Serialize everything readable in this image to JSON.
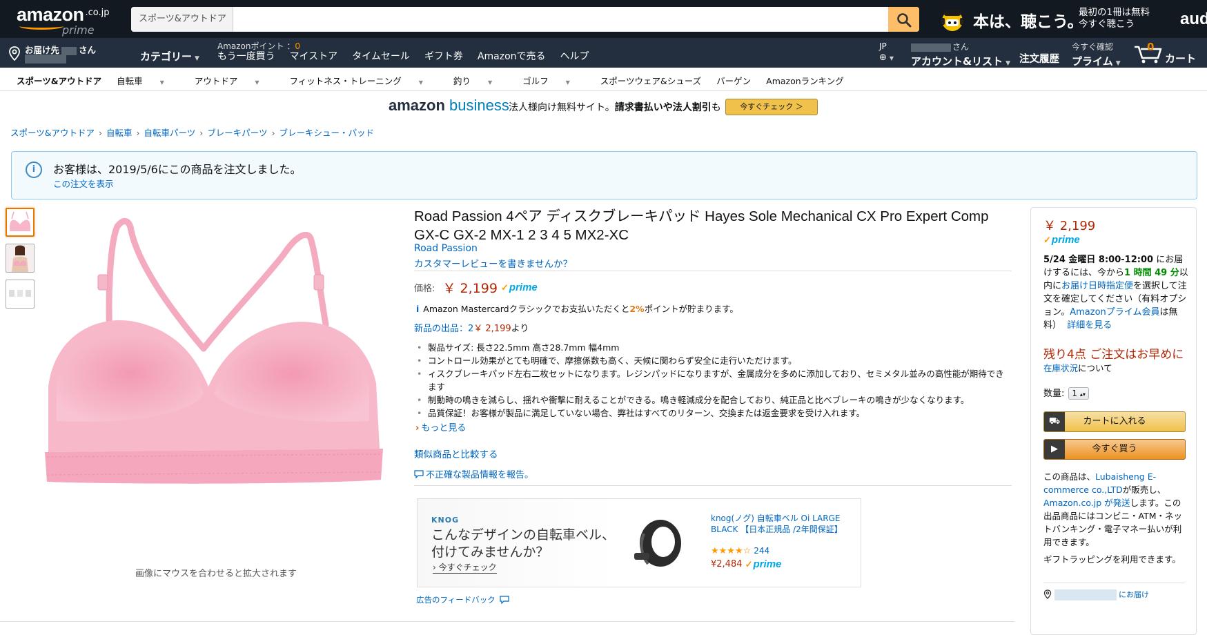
{
  "header": {
    "logo_word": "amazon",
    "logo_suffix": ".co.jp",
    "logo_prime": "prime",
    "search_category": "スポーツ&アウトドア",
    "search_value": "",
    "audible_big": "本は、聴こう。",
    "audible_small_1": "最初の1冊は無料",
    "audible_small_2": "今すぐ聴こう",
    "audible_brand": "audible"
  },
  "nav": {
    "deliver_prefix": "お届け先",
    "deliver_suffix": "さん",
    "category": "カテゴリー",
    "points_label": "Amazonポイント ：",
    "points_value": "0",
    "links": [
      "もう一度買う",
      "マイストア",
      "タイムセール",
      "ギフト券",
      "Amazonで売る",
      "ヘルプ"
    ],
    "lang": "JP",
    "account_suffix": "さん",
    "account": "アカウント&リスト",
    "orders": "注文履歴",
    "prime_top": "今すぐ確認",
    "prime": "プライム",
    "cart_count": "0",
    "cart": "カート"
  },
  "subnav": {
    "items": [
      "スポーツ&アウトドア",
      "自転車",
      "アウトドア",
      "フィットネス・トレーニング",
      "釣り",
      "ゴルフ",
      "スポーツウェア&シューズ",
      "バーゲン",
      "Amazonランキング"
    ]
  },
  "business": {
    "logo_a": "amazon",
    "logo_b": "business",
    "text_pre": "法人様向け無料サイト。",
    "text_bold": "請求書払いや法人割引",
    "text_post": "も",
    "cta": "今すぐチェック ＞"
  },
  "breadcrumb": [
    "スポーツ&アウトドア",
    "自転車",
    "自転車パーツ",
    "ブレーキパーツ",
    "ブレーキシュー・パッド"
  ],
  "order_alert": {
    "icon": "i",
    "message": "お客様は、2019/5/6にこの商品を注文しました。",
    "link": "この注文を表示"
  },
  "gallery": {
    "zoom_hint": "画像にマウスを合わせると拡大されます"
  },
  "product": {
    "title": "Road Passion 4ペア ディスクブレーキパッド Hayes Sole Mechanical CX Pro Expert Comp GX-C GX-2 MX-1 2 3 4 5 MX2-XC",
    "brand": "Road Passion",
    "review_link": "カスタマーレビューを書きませんか？",
    "price_label": "価格:",
    "price": "￥ 2,199",
    "prime": "prime",
    "card_icon": "i",
    "card_pre": "Amazon Mastercardクラシックでお支払いただくと",
    "card_pct": "2%",
    "card_post": "ポイントが貯まります。",
    "new_offers_link": "新品の出品：2",
    "new_offers_price": "￥ 2,199",
    "new_offers_suffix": "より",
    "bullets": [
      "製品サイズ: 長さ22.5mm 高さ28.7mm 幅4mm",
      "コントロール効果がとても明確で、摩擦係数も高く、天候に関わらず安全に走行いただけます。",
      "ィスクブレーキパッド左右二枚セットになります。レジンパッドになりますが、金属成分を多めに添加しており、セミメタル並みの高性能が期待できます",
      "制動時の鳴きを減らし、揺れや衝撃に耐えることができる。鳴き軽減成分を配合しており、純正品と比べブレーキの鳴きが少なくなります。",
      "品質保証！お客様が製品に満足していない場合、弊社はすべてのリターン、交換または返金要求を受け入れます。"
    ],
    "more": "もっと見る",
    "compare": "類似商品と比較する",
    "report": "不正確な製品情報を報告。"
  },
  "ad": {
    "brand": "KNOG",
    "headline": "こんなデザインの自転車ベル、付けてみませんか？",
    "cta": "今すぐチェック",
    "product_title": "knog(ノグ) 自転車ベル Oi LARGE BLACK 【日本正規品 /2年間保証】",
    "rating_count": "244",
    "rating": 4.5,
    "price": "¥2,484",
    "feedback": "広告のフィードバック"
  },
  "buybox": {
    "price": "￥ 2,199",
    "delivery_date": "5/24 金曜日 8:00-12:00",
    "delivery_1": " にお届けするには、今から",
    "countdown": "1 時間 49 分",
    "delivery_2": "以内に",
    "delivery_link": "お届け日時指定便",
    "delivery_3": "を選択して注文を確定してください（有料オプション。",
    "prime_member_link": "Amazonプライム会員",
    "delivery_4": "は無料）",
    "details": "詳細を見る",
    "stock": "残り4点 ご注文はお早めに",
    "stock_link": "在庫状況",
    "stock_suffix": "について",
    "qty_label": "数量:",
    "qty_value": "1",
    "add_to_cart": "カートに入れる",
    "buy_now": "今すぐ買う",
    "seller_pre": "この商品は、",
    "seller_link": "Lubaisheng E-commerce co.,LTD",
    "seller_mid": "が販売し、",
    "ship_link": "Amazon.co.jp が発送",
    "seller_post": "します。この出品商品にはコンビニ・ATM・ネットバンキング・電子マネー払いが利用できます。",
    "gift": "ギフトラッピングを利用できます。",
    "address_suffix": "にお届け"
  }
}
